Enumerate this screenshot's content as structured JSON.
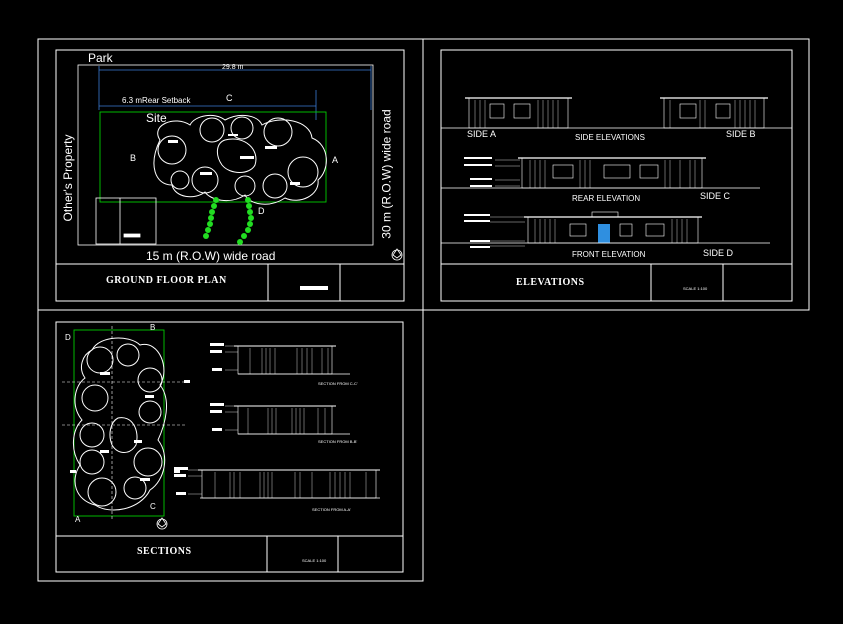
{
  "drawing": {
    "panels": {
      "ground_floor_plan": {
        "title": "GROUND FLOOR PLAN",
        "labels": {
          "park": "Park",
          "width_dim": "29.8 m",
          "rear_setback": "6.3 mRear Setback",
          "site": "Site",
          "others_property": "Other's Property",
          "road_bottom": "15 m (R.O.W) wide road",
          "road_right": "30 m (R.O.W) wide road",
          "side_a": "A",
          "side_b": "B",
          "side_c": "C",
          "side_d": "D"
        }
      },
      "elevations": {
        "title": "ELEVATIONS",
        "scale": "SCALE 1:100",
        "labels": {
          "side_a": "SIDE A",
          "side_b": "SIDE B",
          "side_c": "SIDE C",
          "side_d": "SIDE D",
          "side_elevations": "SIDE ELEVATIONS",
          "rear_elevation": "REAR ELEVATION",
          "front_elevation": "FRONT ELEVATION"
        }
      },
      "sections": {
        "title": "SECTIONS",
        "scale": "SCALE 1:100",
        "labels": {
          "corner_a": "A",
          "corner_b": "B",
          "corner_c": "C",
          "corner_d": "D",
          "section_cc": "SECTION FROM C-C'",
          "section_bb": "SECTION FROM B-B'",
          "section_aa": "SECTION FROM A-A'"
        }
      }
    },
    "colors": {
      "background": "#000000",
      "lines": "#ffffff",
      "site_boundary": "#00cc00",
      "dimension": "#3a7bd5",
      "trees": "#22dd22",
      "door": "#2f8fe0"
    }
  }
}
